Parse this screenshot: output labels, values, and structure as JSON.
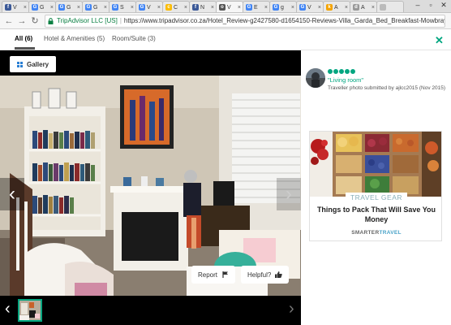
{
  "browser": {
    "tabs": [
      {
        "label": "V",
        "color": "#3b5998",
        "glyph": "f"
      },
      {
        "label": "G",
        "color": "#4285f4",
        "glyph": "G"
      },
      {
        "label": "G",
        "color": "#4285f4",
        "glyph": "G"
      },
      {
        "label": "G",
        "color": "#4285f4",
        "glyph": "G"
      },
      {
        "label": "S",
        "color": "#4285f4",
        "glyph": "G"
      },
      {
        "label": "V",
        "color": "#4285f4",
        "glyph": "G"
      },
      {
        "label": "C",
        "color": "#fbbc05",
        "glyph": "c"
      },
      {
        "label": "N",
        "color": "#3b5998",
        "glyph": "f"
      },
      {
        "label": "V",
        "color": "#555555",
        "glyph": "o"
      },
      {
        "label": "E",
        "color": "#4285f4",
        "glyph": "G"
      },
      {
        "label": "g",
        "color": "#4285f4",
        "glyph": "G"
      },
      {
        "label": "V",
        "color": "#4285f4",
        "glyph": "G"
      },
      {
        "label": "A",
        "color": "#f4a300",
        "glyph": "k"
      },
      {
        "label": "A",
        "color": "#999999",
        "glyph": "d"
      },
      {
        "label": "",
        "color": "#bbbbbb",
        "glyph": ""
      }
    ],
    "site_identity": "TripAdvisor LLC [US]",
    "url": "https://www.tripadvisor.co.za/Hotel_Review-g2427580-d1654150-Reviews-Villa_Garda_Bed_Breakfast-Mowbray..."
  },
  "viewer": {
    "tabs": [
      "All (6)",
      "Hotel & Amenities (5)",
      "Room/Suite (3)"
    ],
    "close_glyph": "✕",
    "gallery_label": "Gallery",
    "report_label": "Report",
    "helpful_label": "Helpful?",
    "prev_glyph": "‹",
    "next_glyph": "›"
  },
  "photo_info": {
    "rating_bubbles": 5,
    "title": "\"Living room\"",
    "credit": "Traveller photo submitted by ajlcc2015 (Nov 2015)"
  },
  "ad": {
    "kicker": "TRAVEL GEAR",
    "headline": "Things to Pack That Will Save You Money",
    "brand_a": "SMARTER",
    "brand_b": "TRAVEL"
  },
  "colors": {
    "accent": "#00a680",
    "secure": "#0b8043"
  }
}
